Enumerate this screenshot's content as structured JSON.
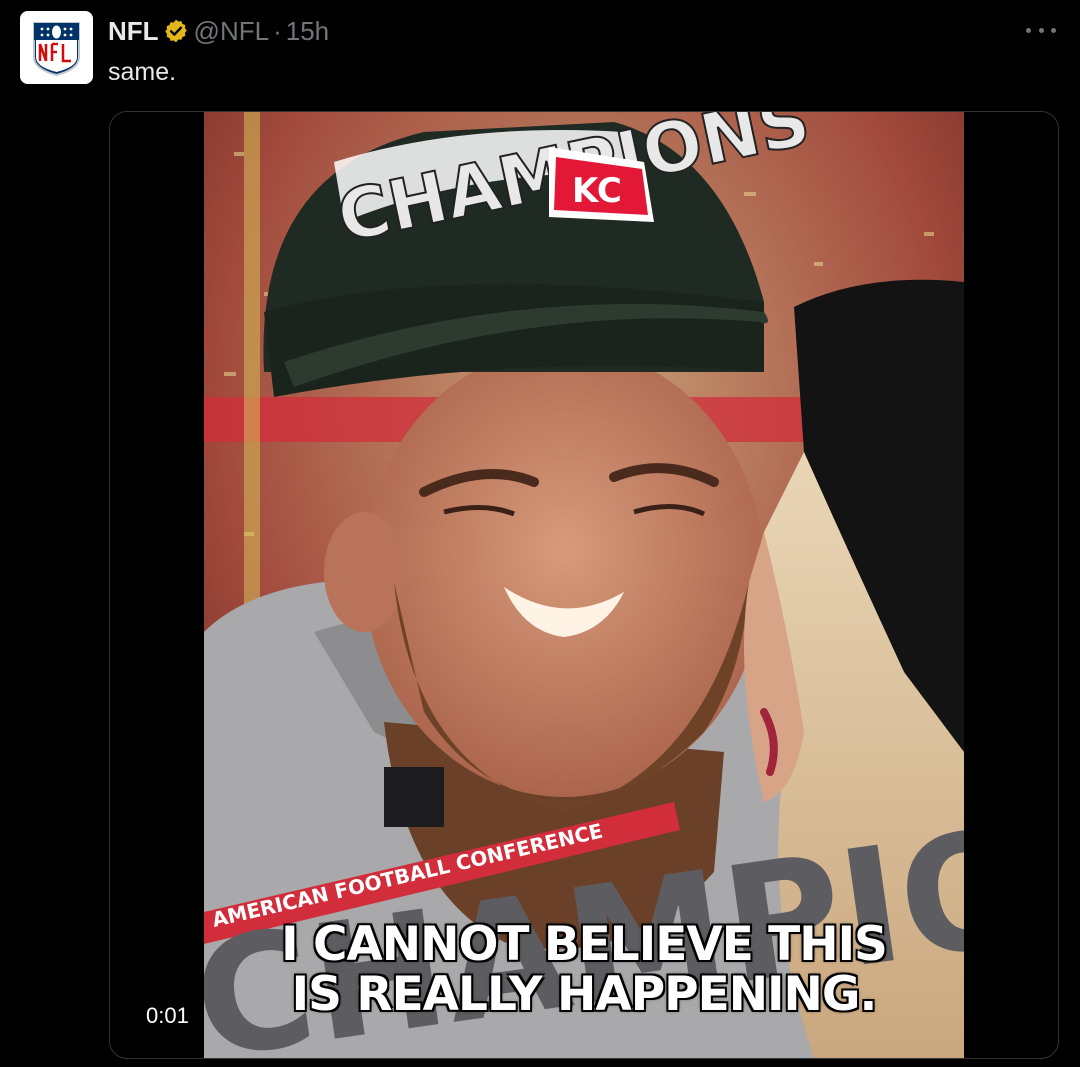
{
  "tweet": {
    "display_name": "NFL",
    "handle": "@NFL",
    "separator": "·",
    "time": "15h",
    "text": "same.",
    "verified_icon": "verified-badge-icon",
    "more_icon": "more-options-icon",
    "avatar_icon": "nfl-shield-logo"
  },
  "media": {
    "caption": "I CANNOT BELIEVE THIS\nIS REALLY HAPPENING.",
    "timer": "0:01",
    "cap_text": "CHAMPIONS",
    "cap_logo_text": "KC",
    "shirt_banner_text": "AMERICAN FOOTBALL CONFERENCE",
    "shirt_big_text": "CHAMPIONS",
    "avatar_logo_text": "NFL"
  },
  "colors": {
    "background": "#000000",
    "text_primary": "#e7e9ea",
    "text_secondary": "#71767b",
    "verified_gold": "#e2b719",
    "media_border": "#2f3336"
  }
}
